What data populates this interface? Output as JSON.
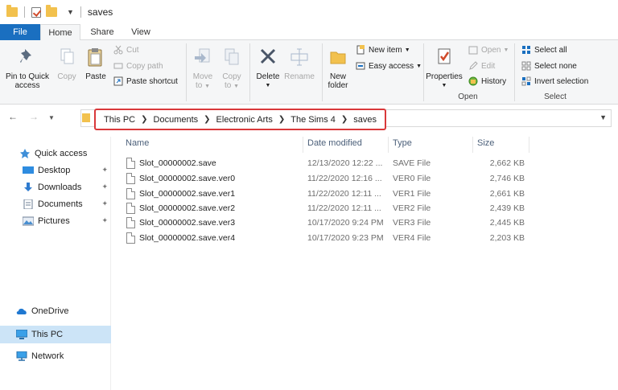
{
  "window": {
    "title": "saves"
  },
  "ribbon_tabs": [
    {
      "label": "File"
    },
    {
      "label": "Home"
    },
    {
      "label": "Share"
    },
    {
      "label": "View"
    }
  ],
  "ribbon": {
    "clipboard": {
      "pin_label_1": "Pin to Quick",
      "pin_label_2": "access",
      "copy": "Copy",
      "paste": "Paste",
      "cut": "Cut",
      "copy_path": "Copy path",
      "paste_shortcut": "Paste shortcut"
    },
    "organize": {
      "move_to_1": "Move",
      "move_to_2": "to",
      "copy_to_1": "Copy",
      "copy_to_2": "to",
      "delete": "Delete",
      "rename": "Rename"
    },
    "new": {
      "new_folder_1": "New",
      "new_folder_2": "folder",
      "new_item": "New item",
      "easy_access": "Easy access"
    },
    "open": {
      "properties": "Properties",
      "open": "Open",
      "edit": "Edit",
      "history": "History",
      "group_label": "Open"
    },
    "select": {
      "select_all": "Select all",
      "select_none": "Select none",
      "invert_selection": "Invert selection",
      "group_label": "Select"
    }
  },
  "address": {
    "crumbs": [
      "This PC",
      "Documents",
      "Electronic Arts",
      "The Sims 4",
      "saves"
    ]
  },
  "nav_pane": {
    "quick_access": "Quick access",
    "items": [
      {
        "label": "Desktop"
      },
      {
        "label": "Downloads"
      },
      {
        "label": "Documents"
      },
      {
        "label": "Pictures"
      }
    ],
    "onedrive": "OneDrive",
    "this_pc": "This PC",
    "network": "Network"
  },
  "file_list": {
    "columns": {
      "name": "Name",
      "date": "Date modified",
      "type": "Type",
      "size": "Size"
    },
    "rows": [
      {
        "name": "Slot_00000002.save",
        "date": "12/13/2020 12:22 ...",
        "type": "SAVE File",
        "size": "2,662 KB"
      },
      {
        "name": "Slot_00000002.save.ver0",
        "date": "11/22/2020 12:16 ...",
        "type": "VER0 File",
        "size": "2,746 KB"
      },
      {
        "name": "Slot_00000002.save.ver1",
        "date": "11/22/2020 12:11 ...",
        "type": "VER1 File",
        "size": "2,661 KB"
      },
      {
        "name": "Slot_00000002.save.ver2",
        "date": "11/22/2020 12:11 ...",
        "type": "VER2 File",
        "size": "2,439 KB"
      },
      {
        "name": "Slot_00000002.save.ver3",
        "date": "10/17/2020 9:24 PM",
        "type": "VER3 File",
        "size": "2,445 KB"
      },
      {
        "name": "Slot_00000002.save.ver4",
        "date": "10/17/2020 9:23 PM",
        "type": "VER4 File",
        "size": "2,203 KB"
      }
    ]
  },
  "colors": {
    "file_tab": "#1a6fc0",
    "highlight_box": "#d9383a",
    "selected_nav": "#cce4f7",
    "folder": "#f2c14e"
  }
}
